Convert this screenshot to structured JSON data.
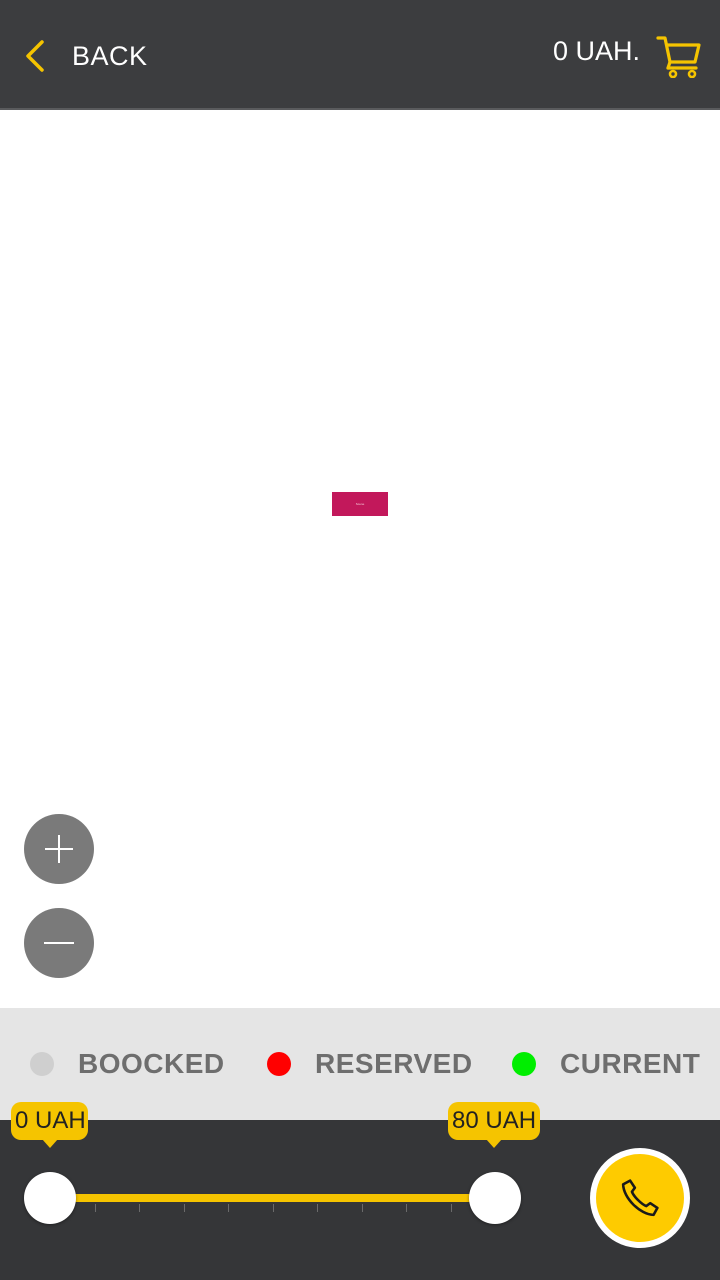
{
  "header": {
    "back_label": "BACK",
    "total_price": "0 UAH.",
    "back_icon": "chevron-left-icon",
    "cart_icon": "cart-icon"
  },
  "map": {
    "stage_label": "Scene"
  },
  "zoom": {
    "in_icon": "plus-icon",
    "out_icon": "minus-icon"
  },
  "legend": {
    "items": [
      {
        "label": "BOOCKED",
        "color": "#cfcfcf"
      },
      {
        "label": "RESERVED",
        "color": "#ff0000"
      },
      {
        "label": "CURRENT",
        "color": "#00ee00"
      }
    ]
  },
  "price_filter": {
    "min_label": "0 UAH",
    "max_label": "80 UAH"
  },
  "call": {
    "icon": "phone-icon"
  },
  "colors": {
    "accent": "#fecb00",
    "header_bg": "#3c3d3f",
    "stage": "#c2185b"
  }
}
